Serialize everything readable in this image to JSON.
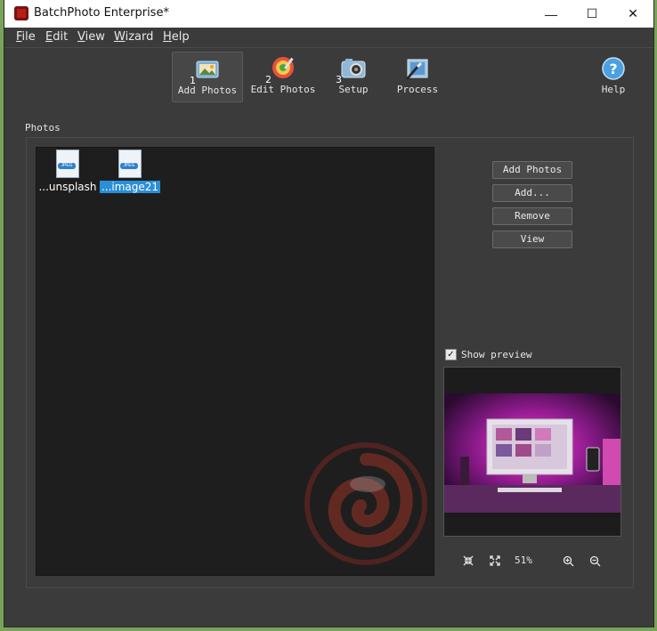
{
  "window": {
    "title": "BatchPhoto Enterprise*",
    "controls": {
      "minimize": "—",
      "maximize": "☐",
      "close": "✕"
    }
  },
  "menu": [
    "File",
    "Edit",
    "View",
    "Wizard",
    "Help"
  ],
  "toolbar": {
    "items": [
      {
        "num": "1",
        "label": "Add Photos",
        "icon": "add-photos-icon",
        "active": true
      },
      {
        "num": "2",
        "label": "Edit Photos",
        "icon": "edit-photos-icon",
        "active": false
      },
      {
        "num": "3",
        "label": "Setup",
        "icon": "setup-icon",
        "active": false
      },
      {
        "num": "",
        "label": "Process",
        "icon": "process-icon",
        "active": false
      }
    ],
    "help_label": "Help"
  },
  "photos_section": {
    "title": "Photos",
    "files": [
      {
        "name": "...unsplash",
        "badge": "JPEG",
        "selected": false
      },
      {
        "name": "...image21",
        "badge": "JPEG",
        "selected": true
      }
    ]
  },
  "side_buttons": [
    "Add Photos",
    "Add...",
    "Remove",
    "View"
  ],
  "preview": {
    "show_preview_label": "Show preview",
    "checked": true,
    "zoom": "51%"
  },
  "colors": {
    "accent_selection": "#2a8fd8",
    "window_bg": "#3b3b3b",
    "list_bg": "#1e1e1e"
  }
}
